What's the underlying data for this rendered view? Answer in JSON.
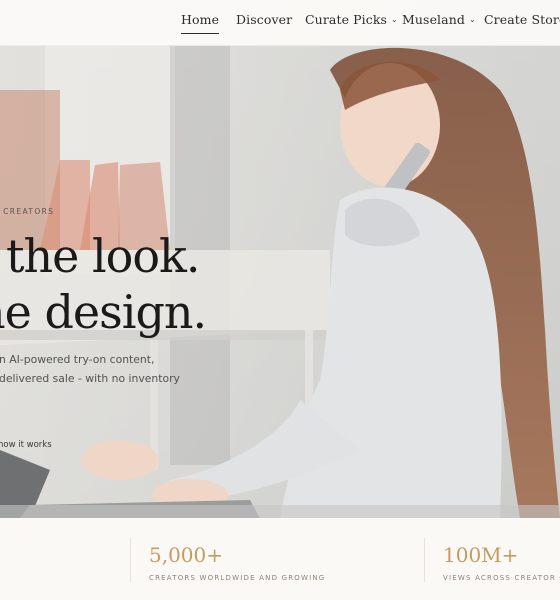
{
  "nav": {
    "items": [
      {
        "label": "Home",
        "active": true,
        "has_dropdown": false
      },
      {
        "label": "Discover",
        "active": false,
        "has_dropdown": false
      },
      {
        "label": "Curate Picks",
        "active": false,
        "has_dropdown": true
      },
      {
        "label": "Museland",
        "active": false,
        "has_dropdown": true
      },
      {
        "label": "Create Store",
        "active": false,
        "has_dropdown": false
      }
    ],
    "dropdown_icon": "chevron-down-icon"
  },
  "hero": {
    "eyebrow": "M FOR CREATORS",
    "headline_line1": "the look.",
    "headline_line2": "ne design.",
    "subcopy_line1": "n AI-powered try-on content,",
    "subcopy_line2": "delivered sale - with no inventory",
    "cta_link": "how it works"
  },
  "stats": [
    {
      "value": "5,000+",
      "label": "CREATORS WORLDWIDE AND GROWING"
    },
    {
      "value": "100M+",
      "label": "VIEWS ACROSS CREATOR C"
    }
  ],
  "colors": {
    "accent": "#c79a62",
    "text_dark": "#1b1a19",
    "nav_bg": "#fcfbf9",
    "stats_bg": "#fbf9f6"
  }
}
